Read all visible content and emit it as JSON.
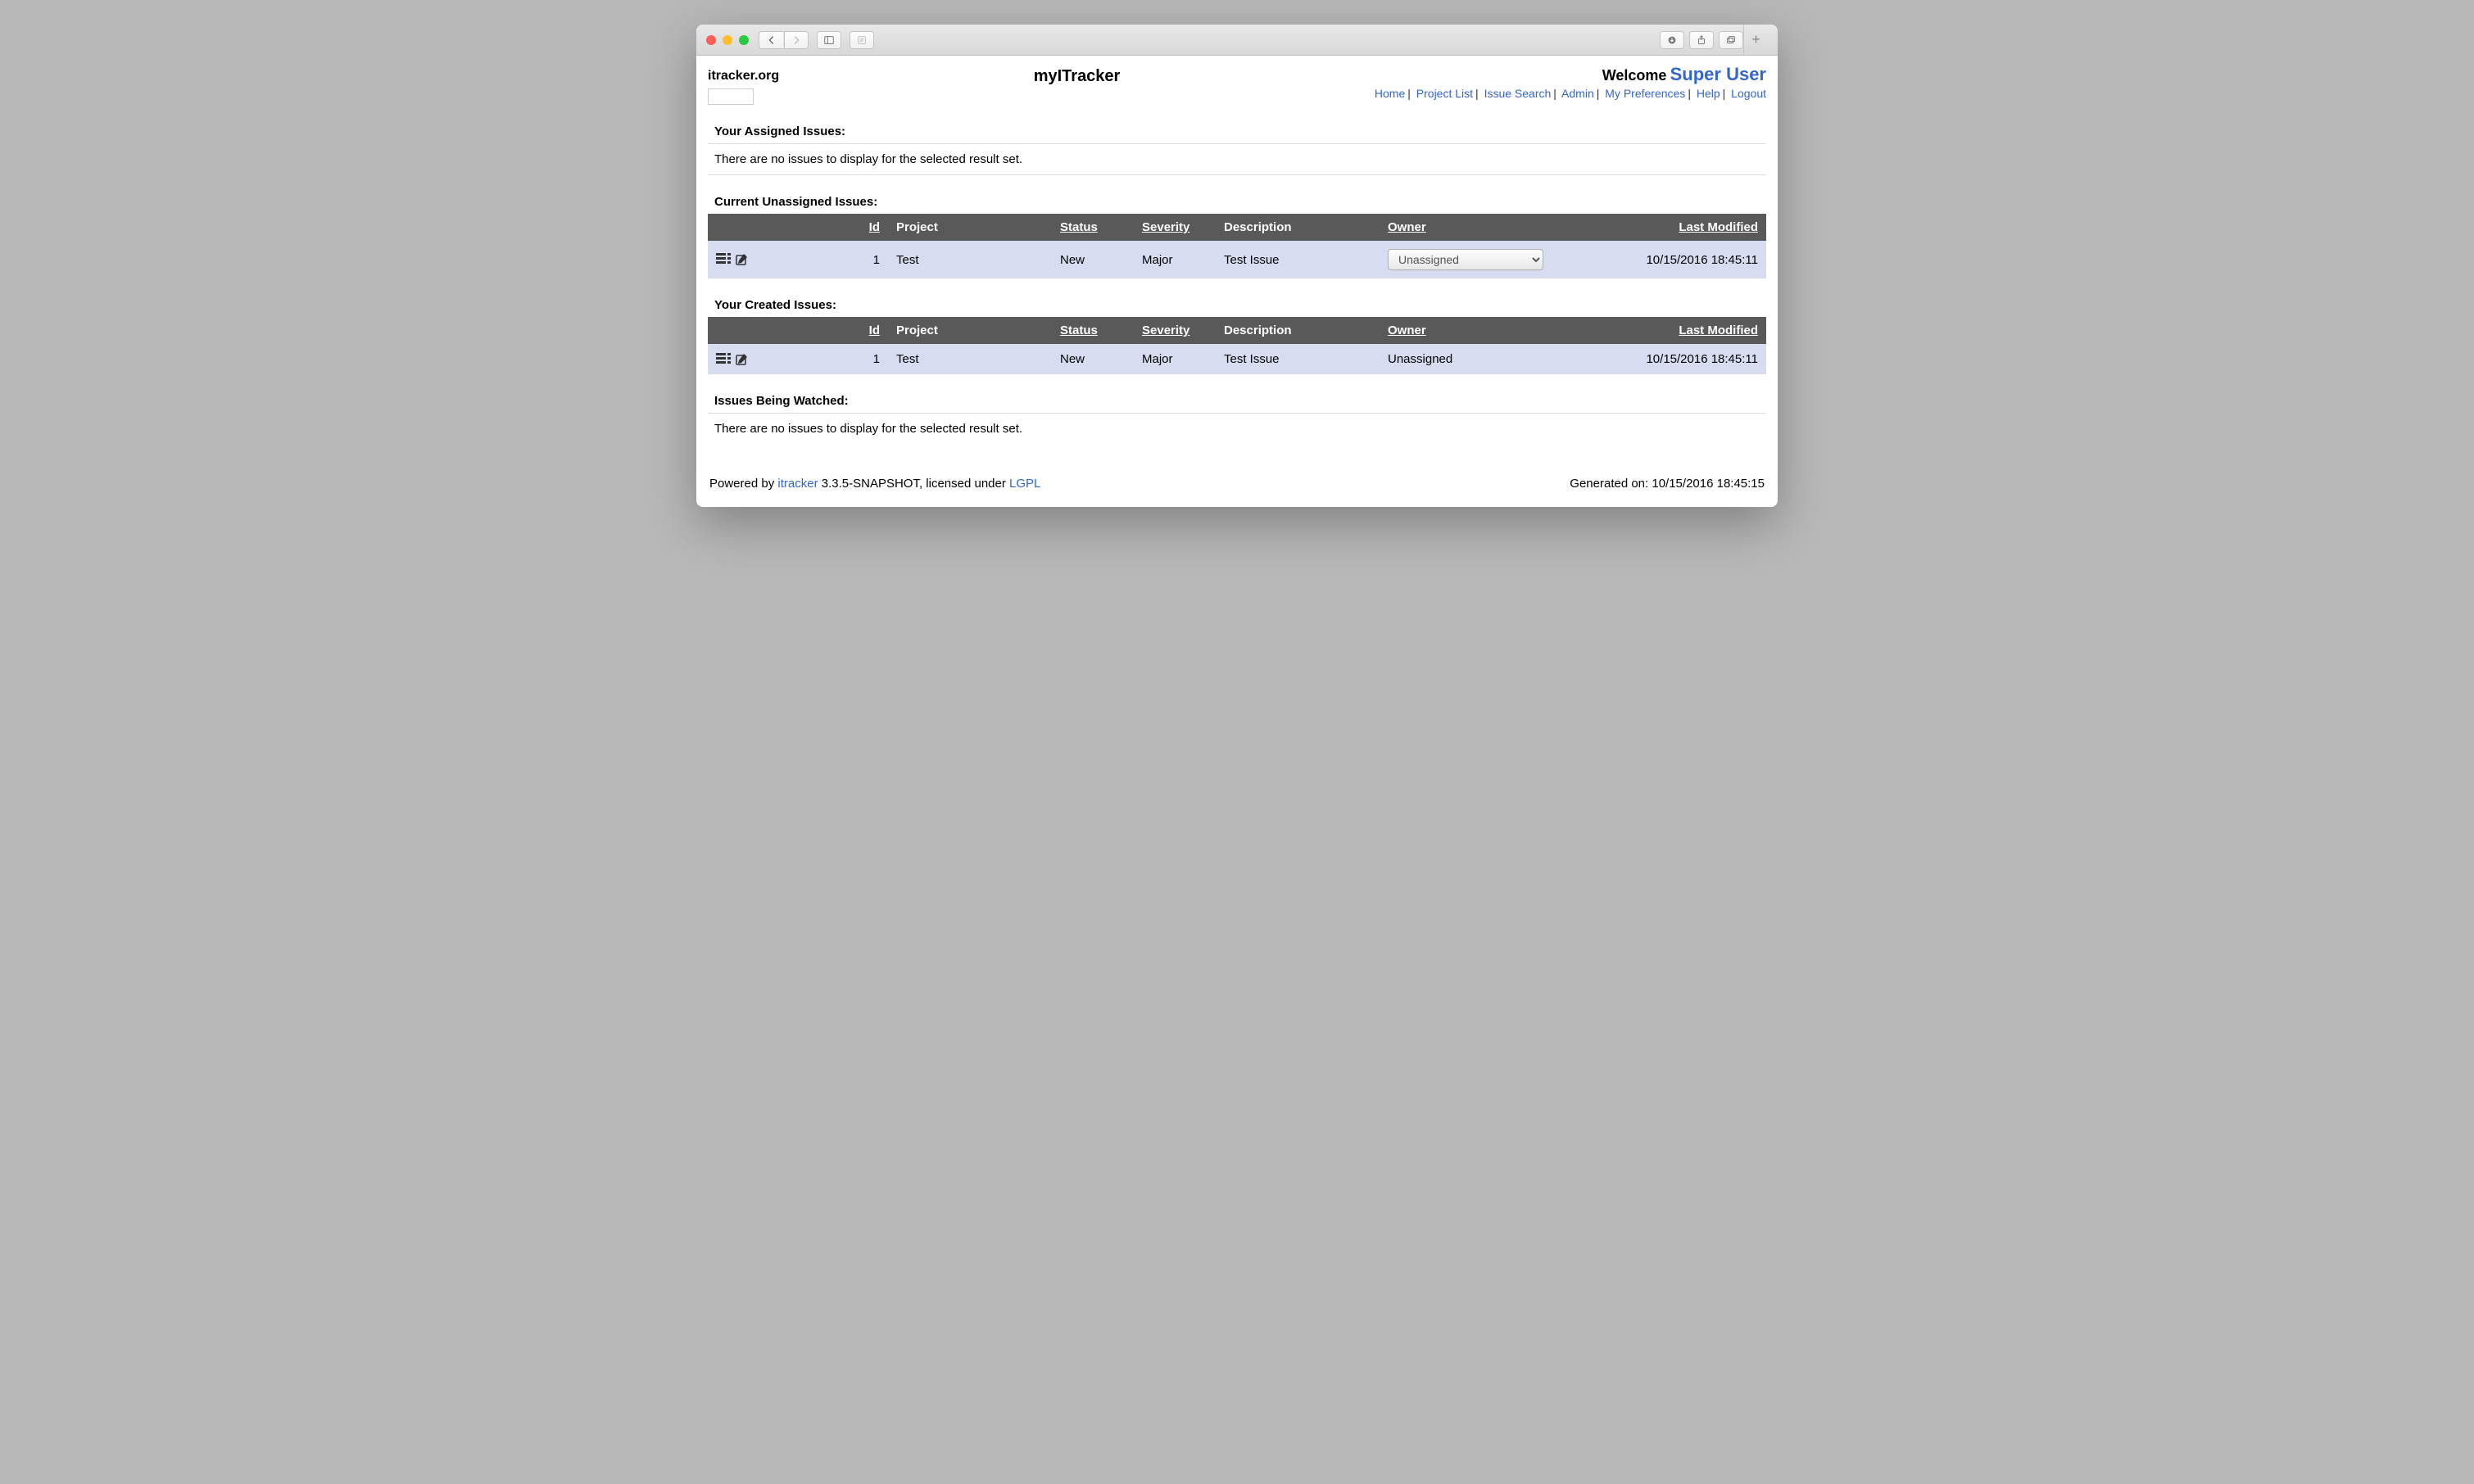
{
  "site_title": "itracker.org",
  "app_title": "myITracker",
  "welcome_label": "Welcome",
  "user_name": "Super User",
  "nav": {
    "home": "Home",
    "project_list": "Project List",
    "issue_search": "Issue Search",
    "admin": "Admin",
    "my_preferences": "My Preferences",
    "help": "Help",
    "logout": "Logout"
  },
  "sections": {
    "assigned": {
      "title": "Your Assigned Issues:",
      "empty_msg": "There are no issues to display for the selected result set."
    },
    "unassigned": {
      "title": "Current Unassigned Issues:"
    },
    "created": {
      "title": "Your Created Issues:"
    },
    "watched": {
      "title": "Issues Being Watched:",
      "empty_msg": "There are no issues to display for the selected result set."
    }
  },
  "columns": {
    "id": "Id",
    "project": "Project",
    "status": "Status",
    "severity": "Severity",
    "description": "Description",
    "owner": "Owner",
    "last_modified": "Last Modified"
  },
  "unassigned_rows": [
    {
      "id": "1",
      "project": "Test",
      "status": "New",
      "severity": "Major",
      "description": "Test Issue",
      "owner_selected": "Unassigned",
      "last_modified": "10/15/2016 18:45:11"
    }
  ],
  "created_rows": [
    {
      "id": "1",
      "project": "Test",
      "status": "New",
      "severity": "Major",
      "description": "Test Issue",
      "owner": "Unassigned",
      "last_modified": "10/15/2016 18:45:11"
    }
  ],
  "footer": {
    "powered_by": "Powered by ",
    "itracker_link": "itracker",
    "version_text": " 3.3.5-SNAPSHOT, licensed under ",
    "license_link": "LGPL",
    "generated_label": "Generated on: ",
    "generated_time": "10/15/2016 18:45:15"
  }
}
